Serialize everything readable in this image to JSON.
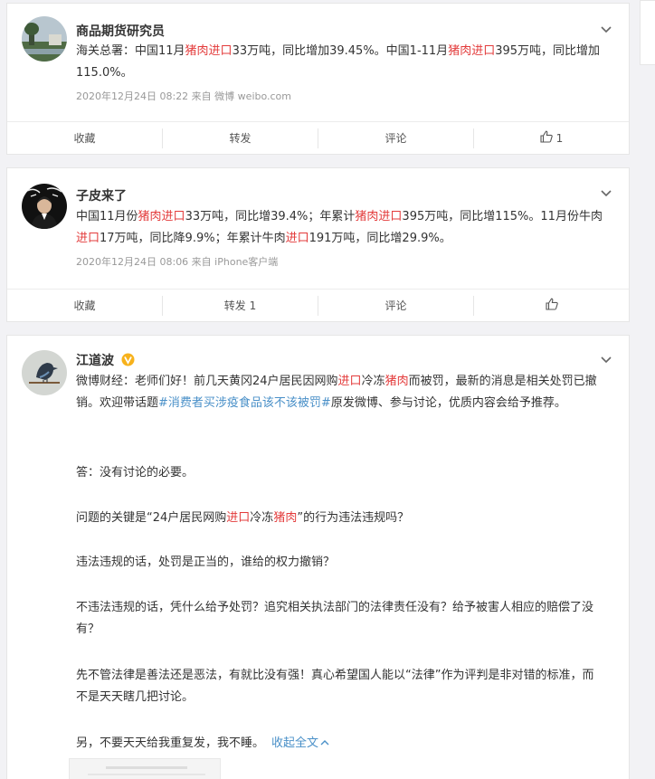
{
  "posts": [
    {
      "author": "商品期货研究员",
      "text_segments": [
        {
          "t": "海关总署：中国11月",
          "h": false
        },
        {
          "t": "猪肉进口",
          "h": true
        },
        {
          "t": "33万吨，同比增加39.45%。中国1-11月",
          "h": false
        },
        {
          "t": "猪肉进口",
          "h": true
        },
        {
          "t": "395万吨，同比增加115.0%。",
          "h": false
        }
      ],
      "meta": "2020年12月24日 08:22  来自 微博 weibo.com",
      "actions": {
        "collect": "收藏",
        "repost": "转发",
        "comment": "评论",
        "like_count": "1"
      }
    },
    {
      "author": "子皮来了",
      "text_segments": [
        {
          "t": "中国11月份",
          "h": false
        },
        {
          "t": "猪肉进口",
          "h": true
        },
        {
          "t": "33万吨，同比增39.4%；年累计",
          "h": false
        },
        {
          "t": "猪肉进口",
          "h": true
        },
        {
          "t": "395万吨，同比增115%。11月份牛肉",
          "h": false
        },
        {
          "t": "进口",
          "h": true
        },
        {
          "t": "17万吨，同比降9.9%；年累计牛肉",
          "h": false
        },
        {
          "t": "进口",
          "h": true
        },
        {
          "t": "191万吨，同比增29.9%。",
          "h": false
        }
      ],
      "meta": "2020年12月24日 08:06  来自 iPhone客户端",
      "actions": {
        "collect": "收藏",
        "repost": "转发 1",
        "comment": "评论",
        "like_count": ""
      }
    },
    {
      "author": "江道波",
      "verified": "V",
      "p1": [
        {
          "t": "微博财经：老师们好！前几天黄冈24户居民因网购",
          "h": false
        },
        {
          "t": "进口",
          "h": true
        },
        {
          "t": "冷冻",
          "h": false
        },
        {
          "t": "猪肉",
          "h": true
        },
        {
          "t": "而被罚，最新的消息是相关处罚已撤销。欢迎带话题",
          "h": false
        },
        {
          "t": "#消费者买涉疫食品该不该被罚#",
          "topic": true
        },
        {
          "t": "原发微博、参与讨论，优质内容会给予推荐。",
          "h": false
        }
      ],
      "p2": "答：没有讨论的必要。",
      "p3": [
        {
          "t": "问题的关键是“24户居民网购",
          "h": false
        },
        {
          "t": "进口",
          "h": true
        },
        {
          "t": "冷冻",
          "h": false
        },
        {
          "t": "猪肉",
          "h": true
        },
        {
          "t": "”的行为违法违规吗？",
          "h": false
        }
      ],
      "p4": "违法违规的话，处罚是正当的，谁给的权力撤销？",
      "p5": "不违法违规的话，凭什么给予处罚？追究相关执法部门的法律责任没有？给予被害人相应的赔偿了没有？",
      "p6": "先不管法律是善法还是恶法，有就比没有强！真心希望国人能以“法律”作为评判是非对错的标准，而不是天天瞎几把讨论。",
      "p7": "另，不要天天给我重复发，我不睡。",
      "collapse_label": "收起全文"
    }
  ],
  "colors": {
    "highlight": "#e33b3b",
    "link": "#4a90c8"
  }
}
